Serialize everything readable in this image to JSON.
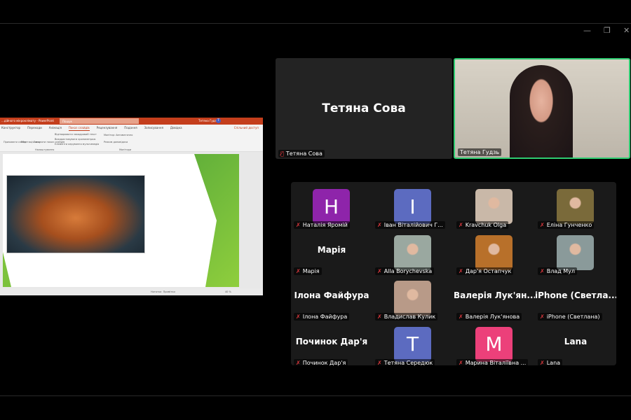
{
  "window": {
    "controls": [
      "—",
      "❐",
      "✕"
    ]
  },
  "ppt": {
    "title": "...дійного мікроклімату - PowerPoint",
    "search": "Пошук",
    "user": "Тетяна Гудзь",
    "user_initial": "Т",
    "share": "Спільний доступ",
    "tabs": [
      "Конструктор",
      "Переходи",
      "Анімація",
      "Показ слайдів",
      "Рецензування",
      "Подання",
      "Записування",
      "Довідка"
    ],
    "active_tab": "Показ слайдів",
    "ribbon": [
      "Приховати слайд",
      "Репетиція часу",
      "Записати показ слайдів",
      "Відтворювати закадровий текст",
      "Використовувати хронометраж",
      "Елементи керування мультимедіа",
      "Налаштування",
      "Монітор: Автоматично",
      "Режим доповідача",
      "Монітори"
    ],
    "status": [
      "Нотатки",
      "Примітки",
      "40 %"
    ]
  },
  "speakers": [
    {
      "display": "Тетяна Сова",
      "label": "Тетяна Сова",
      "active": false
    },
    {
      "display": "",
      "label": "Тетяна Гудзь",
      "active": true
    }
  ],
  "colors": {
    "active_border": "#2ecc71",
    "mic_muted": "#e0393e"
  },
  "participants": [
    {
      "label": "Наталія Яромій",
      "initial": "H",
      "color": "#8e24aa"
    },
    {
      "label": "Іван Віталійович Г...",
      "initial": "I",
      "color": "#5c6bc0"
    },
    {
      "label": "Kravchuk Olga",
      "photo": "#c9b8a8"
    },
    {
      "label": "Еліна Гунченко",
      "photo": "#7a6a3a"
    },
    {
      "label": "Марія",
      "name": "Марія"
    },
    {
      "label": "Alla Borychevska",
      "photo": "#9aa8a0"
    },
    {
      "label": "Дар'я Остапчук",
      "photo": "#b8702a"
    },
    {
      "label": "Влад Мул",
      "photo": "#8a9a9a"
    },
    {
      "label": "Ілона Файфура",
      "name": "Ілона Файфура"
    },
    {
      "label": "Владислав Кулик",
      "photo": "#b89a88"
    },
    {
      "label": "Валерія Лук'янова",
      "name": "Валерія Лук'ян..."
    },
    {
      "label": "iPhone (Светлана)",
      "name": "iPhone  (Светла..."
    },
    {
      "label": "Починок Дар'я",
      "name": "Починок Дар'я"
    },
    {
      "label": "Тетяна Середюк",
      "initial": "T",
      "color": "#5c6bc0"
    },
    {
      "label": "Марина Віталіївна ...",
      "initial": "M",
      "color": "#ec407a"
    },
    {
      "label": "Lana",
      "name": "Lana"
    }
  ]
}
